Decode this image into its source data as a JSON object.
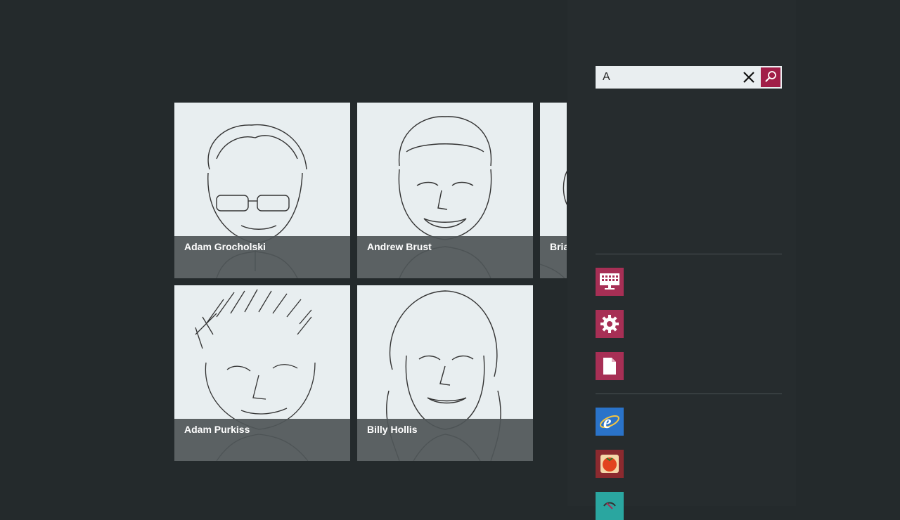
{
  "people": [
    {
      "name": "Adam Grocholski"
    },
    {
      "name": "Andrew Brust"
    },
    {
      "name": "Bria"
    },
    {
      "name": "Adam Purkiss"
    },
    {
      "name": "Billy Hollis"
    }
  ],
  "search": {
    "value": "A"
  },
  "apps": [
    {
      "icon": "keyboard-display-icon",
      "color": "#a72f55"
    },
    {
      "icon": "gear-icon",
      "color": "#a72f55"
    },
    {
      "icon": "document-icon",
      "color": "#a72f55"
    },
    {
      "icon": "internet-explorer-icon",
      "color": "#2a73c9"
    },
    {
      "icon": "tomato-icon",
      "color": "#8b2a2f"
    },
    {
      "icon": "teal-app-icon",
      "color": "#2aa6a0"
    }
  ],
  "colors": {
    "background": "#242a2c",
    "accent": "#a11e48",
    "tile": "#e8eef0"
  }
}
